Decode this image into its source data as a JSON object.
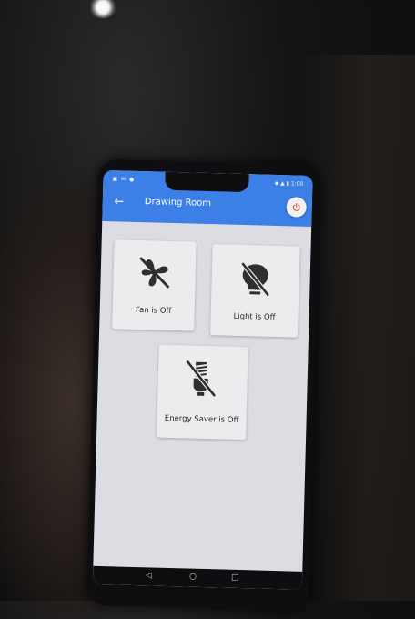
{
  "app": {
    "title": "Drawing Room",
    "accent_color": "#3c7fe6"
  },
  "status_bar": {
    "left": "▣ ✉ ●",
    "right": "◆ ▲ ▮ 1:00"
  },
  "header": {
    "back_icon": "arrow-left-icon",
    "power_icon": "power-icon",
    "power_color": "#e5533b"
  },
  "devices": [
    {
      "name": "fan",
      "label": "Fan is Off",
      "icon": "fan-off-icon"
    },
    {
      "name": "light",
      "label": "Light is Off",
      "icon": "bulb-off-icon"
    },
    {
      "name": "energy-saver",
      "label": "Energy Saver is Off",
      "icon": "energy-saver-off-icon"
    }
  ],
  "nav": {
    "back": "◁",
    "home": "○",
    "recents": "□"
  }
}
